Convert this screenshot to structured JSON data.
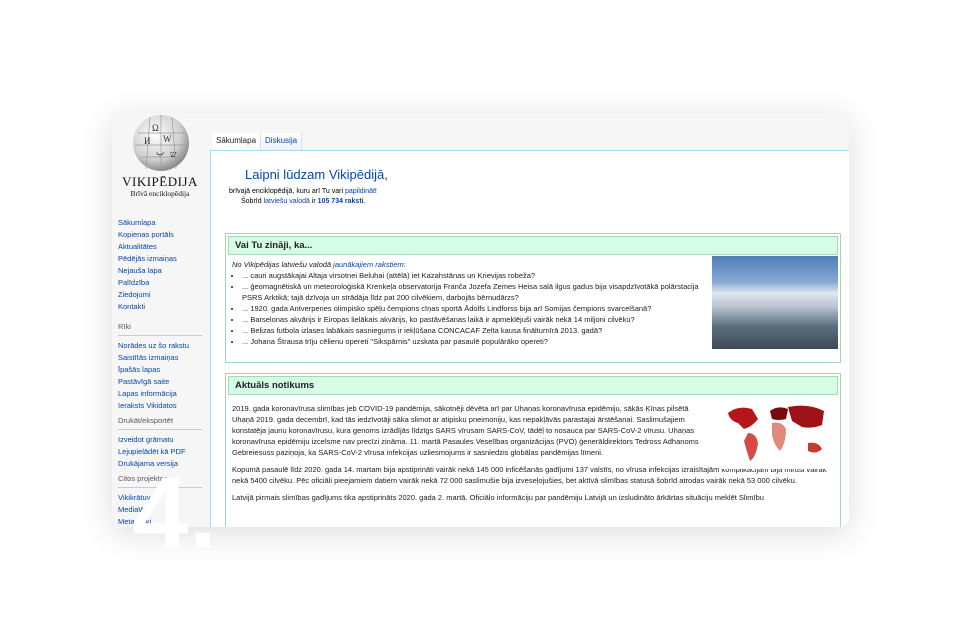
{
  "sidebar": {
    "wordmark": "VIKIPĒDIJA",
    "tagline": "Brīvā enciklopēdija",
    "main_links": [
      "Sākumlapa",
      "Kopienas portāls",
      "Aktualitātes",
      "Pēdējās izmaiņas",
      "Nejauša lapa",
      "Palīdzība",
      "Ziedojumi",
      "Kontakti"
    ],
    "tools_head": "Rīki",
    "tools_links": [
      "Norādes uz šo rakstu",
      "Saistītās izmaiņas",
      "Īpašās lapas",
      "Pastāvīgā saite",
      "Lapas informācija",
      "Ieraksts Vikidatos"
    ],
    "print_head": "Drukāt/eksportēt",
    "print_links": [
      "Izveidot grāmatu",
      "Lejupielādēt kā PDF",
      "Drukājama versija"
    ],
    "projects_head": "Citos projektos",
    "projects_links": [
      "Vikikrātuve",
      "MediaWiki",
      "Meta-Wiki"
    ]
  },
  "tabs": [
    "Sākumlapa",
    "Diskusija"
  ],
  "welcome": {
    "title": "Laipni lūdzam Vikipēdijā,",
    "line1_a": "brīvajā enciklopēdijā, kuru arī Tu vari ",
    "line1_link": "papildināt",
    "line1_b": "!",
    "line2_a": "Šobrīd ",
    "line2_link1": "latviešu valodā",
    "line2_b": " ir ",
    "line2_link2": "105 734 raksti",
    "line2_c": "."
  },
  "dyk": {
    "heading": "Vai Tu zināji, ka...",
    "intro_a": "No Vikipēdijas latviešu valodā ",
    "intro_link": "jaunākajiem rakstiem",
    "intro_b": ":",
    "items": [
      "... cauri augstākajai Altaja virsotnei Beluhai (attēlā) iet Kazahstānas un Krievijas robeža?",
      "... ģeomagnētiskā un meteoroloģiskā Krenkeļa observatorija Franča Jozefa Zemes Heisa salā ilgus gadus bija visapdzīvotākā polārstacija PSRS Arktikā; tajā dzīvoja un strādāja līdz pat 200 cilvēkiem, darbojās bērnudārzs?",
      "... 1920. gada Antverpenes olimpisko spēļu čempions cīņas sportā Ādolfs Lindforss bija arī Somijas čempions svarcelšanā?",
      "... Barselonas akvārijs ir Eiropas lielākais akvārijs, ko pastāvēšanas laikā ir apmeklējuši vairāk nekā 14 miljoni cilvēku?",
      "... Belizas futbola izlases labākais sasniegums ir iekļūšana CONCACAF Zelta kausa finālturnīrā 2013. gadā?",
      "... Johana Štrausa trīju cēlienu opereti \"Sikspārnis\" uzskata par pasaulē populārāko opereti?"
    ]
  },
  "news": {
    "heading": "Aktuāls notikums",
    "p1": "2019. gada koronavīrusa slimības jeb COVID-19 pandēmija, sākotnēji dēvēta arī par Uhaņas koronavīrusa epidēmiju, sākās Ķīnas pilsētā Uhaņā 2019. gada decembrī, kad tās iedzīvotāji sāka slimot ar atipisku pneimoniju, kas nepakļāvās parastajai ārstēšanai. Saslimušajiem konstatēja jaunu koronavīrusu, kura genoms izrādījās līdzīgs SARS vīrusam SARS-CoV, tādēļ to nosauca par SARS-CoV-2 vīrusu. Uhaņas koronavīrusa epidēmiju izcelsme nav precīzi zināma. 11. martā Pasaules Veselības organizācijas (PVO) ģenerāldirektors Tedross Adhanoms Gebreiesuss paziņoja, ka SARS-CoV-2 vīrusa infekcijas uzliesmojums ir sasniedzis globālas pandēmijas līmeni.",
    "p2": "Kopumā pasaulē līdz 2020. gada 14. martam bija apstiprināti vairāk nekā 145 000 inficēšanās gadījumi 137 valstīs, no vīrusa infekcijas izraisītajām komplikācijām bija miruši vairāk nekā 5400 cilvēku. Pēc oficiāli pieejamiem datiem vairāk nekā 72 000 saslimušie bija izveseļojušies, bet aktīvā slimības statusā šobrīd atrodas vairāk nekā 53 000 cilvēku.",
    "p3": "Latvijā pirmais slimības gadījums tika apstiprināts 2020. gada 2. martā. Oficiālo informāciju par pandēmiju Latvijā un izsludināto ārkārtas situāciju meklēt Slimību"
  },
  "overlay_number": "4."
}
